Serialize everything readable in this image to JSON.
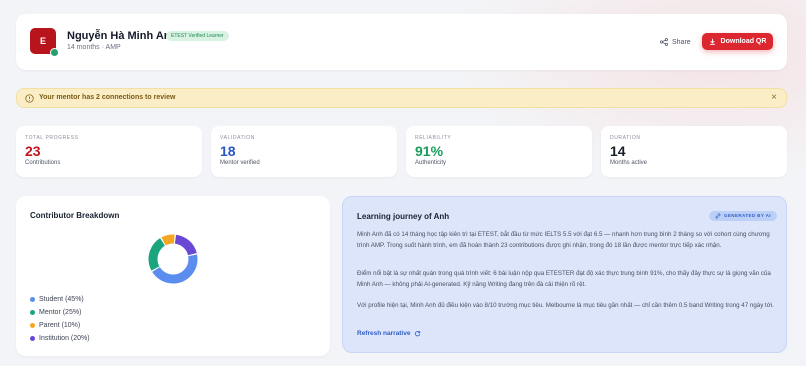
{
  "colors": {
    "brand_red": "#dc2730",
    "avatar_red": "#b8141c",
    "student": "#5b8def",
    "mentor": "#1aa57f",
    "parent": "#f5a623",
    "institution": "#6b47d6"
  },
  "profile": {
    "avatar_initial": "E",
    "name": "Nguyễn Hà Minh Anh",
    "badge": "ETEST Verified Learner",
    "meta": "14 months · AMP"
  },
  "actions": {
    "share_label": "Share",
    "download_label": "Download QR",
    "share_icon": "share-icon",
    "download_icon": "download-icon"
  },
  "alert": {
    "text": "Your mentor has 2 connections to review",
    "close": "×"
  },
  "stats": [
    {
      "label": "TOTAL PROGRESS",
      "value": "23",
      "sub": "Contributions",
      "color": "#c4161e"
    },
    {
      "label": "VALIDATION",
      "value": "18",
      "sub": "Mentor verified",
      "color": "#2a56c6"
    },
    {
      "label": "RELIABILITY",
      "value": "91%",
      "sub": "Authenticity",
      "color": "#1a9c5b"
    },
    {
      "label": "DURATION",
      "value": "14",
      "sub": "Months active",
      "color": "#1a1f2c"
    }
  ],
  "breakdown": {
    "title": "Contributor Breakdown",
    "legend": [
      {
        "label": "Student (45%)",
        "value": 45
      },
      {
        "label": "Mentor (25%)",
        "value": 25
      },
      {
        "label": "Parent (10%)",
        "value": 10
      },
      {
        "label": "Institution (20%)",
        "value": 20
      }
    ]
  },
  "narrative": {
    "title": "Learning journey of Anh",
    "badge": "GENERATED BY AI",
    "paragraphs": [
      "Minh Anh đã có 14 tháng học tập kiên trì tại ETEST, bắt đầu từ mức IELTS 5.5 với đạt 6.5 — nhanh hơn trung bình 2 tháng so với cohort cùng chương trình AMP. Trong suốt hành trình, em đã hoàn thành 23 contributions được ghi nhận, trong đó 18 lần được mentor trực tiếp xác nhận.",
      "Điểm nổi bật là sự nhất quán trong quá trình viết: 6 bài luận nộp qua ETESTER đạt độ xác thực trung bình 91%, cho thấy đây thực sự là giọng văn của Minh Anh — không phải AI-generated. Kỹ năng Writing đang trên đà cải thiện rõ rệt.",
      "Với profile hiện tại, Minh Anh đủ điều kiện vào 8/10 trường mục tiêu. Melbourne là mục tiêu gần nhất — chỉ cần thêm 0.5 band Writing trong 47 ngày tới."
    ],
    "refresh_label": "Refresh narrative"
  }
}
